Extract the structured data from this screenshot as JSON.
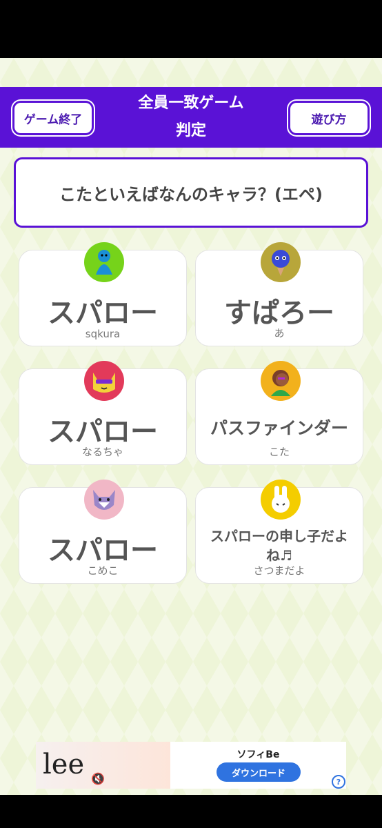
{
  "header": {
    "end_button": "ゲーム終了",
    "title_line1": "全員一致ゲーム",
    "title_line2": "判定",
    "help_button": "遊び方"
  },
  "question": "こたといえばなんのキャラ？(エペ)",
  "answers": [
    {
      "answer": "スパロー",
      "name": "sqkura",
      "avatar_color": "#76d31a",
      "avatar_icon": "pawn-icon"
    },
    {
      "answer": "すぱろー",
      "name": "あ",
      "avatar_color": "#b8a63a",
      "avatar_icon": "balloon-face-icon"
    },
    {
      "answer": "スパロー",
      "name": "なるちゃ",
      "avatar_color": "#e23a5a",
      "avatar_icon": "cat-sunglasses-icon"
    },
    {
      "answer": "パスファインダー",
      "name": "こた",
      "avatar_color": "#f2b11c",
      "avatar_icon": "person-face-icon"
    },
    {
      "answer": "スパロー",
      "name": "こめこ",
      "avatar_color": "#f1b7c6",
      "avatar_icon": "wolf-icon"
    },
    {
      "answer": "スパローの申し子だよね♬",
      "name": "さつまだよ",
      "avatar_color": "#f4cd00",
      "avatar_icon": "rabbit-icon"
    }
  ],
  "ad": {
    "logo_text": "lee",
    "title": "ソフィBe",
    "button": "ダウンロード",
    "help": "?"
  }
}
